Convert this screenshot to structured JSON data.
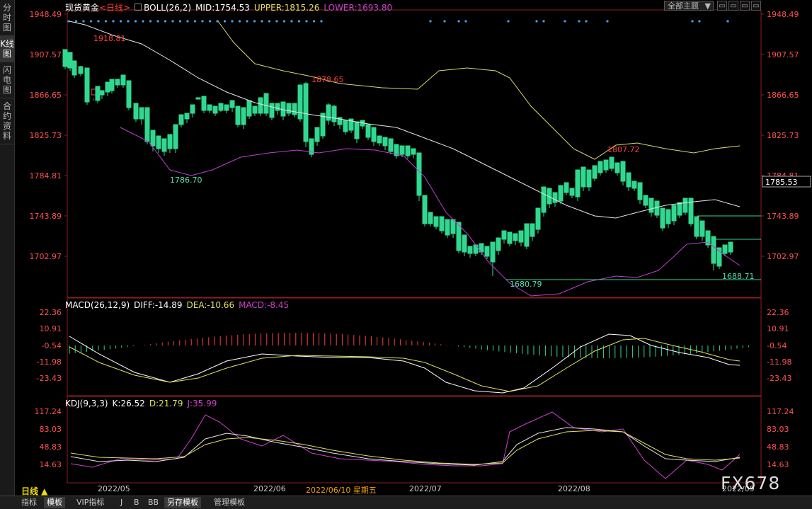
{
  "sidebar": {
    "tabs": [
      {
        "label": "分时图",
        "active": false
      },
      {
        "label": "K线图",
        "active": true
      },
      {
        "label": "闪电图",
        "active": false
      },
      {
        "label": "合约资料",
        "active": false
      }
    ]
  },
  "header": {
    "title": "现货黄金",
    "period_tag": "<日线>",
    "boll_label": "BOLL(26,2)",
    "mid": "MID:1754.53",
    "upper": "UPPER:1815.26",
    "lower": "LOWER:1693.80"
  },
  "template_select": "全部主题",
  "window_buttons": [
    "▭",
    "▭",
    "▭",
    "▭"
  ],
  "price_axis": {
    "labels": [
      "1948.49",
      "1907.57",
      "1866.65",
      "1825.73",
      "1784.81",
      "1743.89",
      "1702.97"
    ],
    "current": "1785.53"
  },
  "annotations": {
    "h1": "1918.81",
    "h2": "1878.65",
    "h3": "1807.72",
    "l1": "1786.70",
    "l2": "1680.79",
    "l3": "1688.71"
  },
  "macd": {
    "label": "MACD(26,12,9)",
    "diff": "DIFF:-14.89",
    "dea": "DEA:-10.66",
    "macd": "MACD:-8.45",
    "axis": [
      "22.36",
      "10.91",
      "-0.54",
      "-11.98",
      "-23.43"
    ]
  },
  "kdj": {
    "label": "KDJ(9,3,3)",
    "k": "K:26.52",
    "d": "D:21.79",
    "j": "J:35.99",
    "axis": [
      "117.24",
      "83.03",
      "48.83",
      "14.63"
    ]
  },
  "period": "日线 ▲",
  "dates": [
    "2022/05",
    "2022/06",
    "2022/07",
    "2022/08",
    "2022/09"
  ],
  "cursor_date": "2022/06/10 星期五",
  "bottom_tabs": [
    "指标",
    "模板",
    "VIP指标",
    "J",
    "B",
    "BB",
    "另存模板",
    "管理模板"
  ],
  "watermark": "FX678",
  "colors": {
    "up": "#ff4040",
    "down": "#30d890",
    "mid": "#e6e6e6",
    "upper": "#d8d870",
    "lower": "#c040d0",
    "diff": "#ffffff",
    "dea": "#e0e060",
    "j": "#d040d0"
  }
}
